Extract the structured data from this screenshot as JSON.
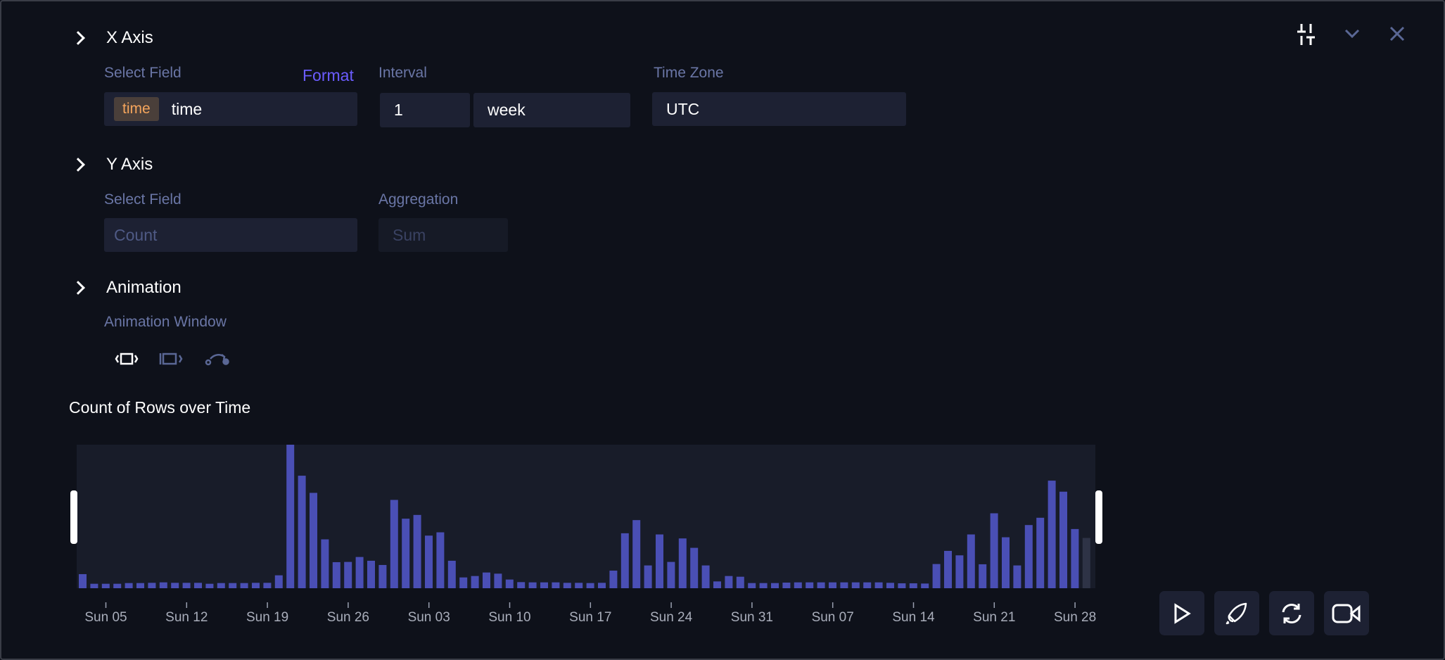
{
  "x_axis": {
    "title": "X Axis",
    "select_field_label": "Select Field",
    "format_link": "Format",
    "field_type_chip": "time",
    "field_value": "time",
    "interval_label": "Interval",
    "interval_value": "1",
    "interval_unit": "week",
    "timezone_label": "Time Zone",
    "timezone_value": "UTC"
  },
  "y_axis": {
    "title": "Y Axis",
    "select_field_label": "Select Field",
    "field_placeholder": "Count",
    "aggregation_label": "Aggregation",
    "aggregation_value": "Sum"
  },
  "animation": {
    "title": "Animation",
    "window_label": "Animation Window",
    "window_modes": [
      "free-window-icon",
      "incremental-window-icon",
      "point-window-icon"
    ]
  },
  "header_icons": [
    "sliders-icon",
    "chevron-down-icon",
    "close-icon"
  ],
  "playback_buttons": [
    "play-icon",
    "rocket-icon",
    "refresh-icon",
    "video-icon"
  ],
  "colors": {
    "bar": "#4a4fb5",
    "bar_current": "#2e3346",
    "accent": "#6b5cff",
    "chip_text": "#f5a55c"
  },
  "chart_data": {
    "type": "bar",
    "title": "Count of Rows over Time",
    "xlabel": "",
    "ylabel": "",
    "tick_labels": [
      "Sun 05",
      "Sun 12",
      "Sun 19",
      "Sun 26",
      "Sun 03",
      "Sun 10",
      "Sun 17",
      "Sun 24",
      "Sun 31",
      "Sun 07",
      "Sun 14",
      "Sun 21",
      "Sun 28"
    ],
    "values": [
      60,
      19,
      19,
      19,
      22,
      22,
      23,
      25,
      23,
      23,
      23,
      19,
      22,
      22,
      22,
      23,
      23,
      55,
      611,
      479,
      406,
      208,
      111,
      112,
      133,
      117,
      99,
      376,
      296,
      312,
      224,
      238,
      117,
      46,
      52,
      67,
      62,
      37,
      26,
      25,
      25,
      25,
      23,
      23,
      22,
      23,
      75,
      234,
      290,
      97,
      229,
      112,
      212,
      172,
      97,
      29,
      52,
      49,
      22,
      22,
      22,
      24,
      25,
      25,
      25,
      25,
      25,
      25,
      25,
      25,
      23,
      21,
      21,
      20,
      103,
      159,
      140,
      229,
      102,
      319,
      217,
      97,
      269,
      300,
      458,
      411,
      252,
      214
    ],
    "last_bar_in_progress": true,
    "grid": false
  }
}
